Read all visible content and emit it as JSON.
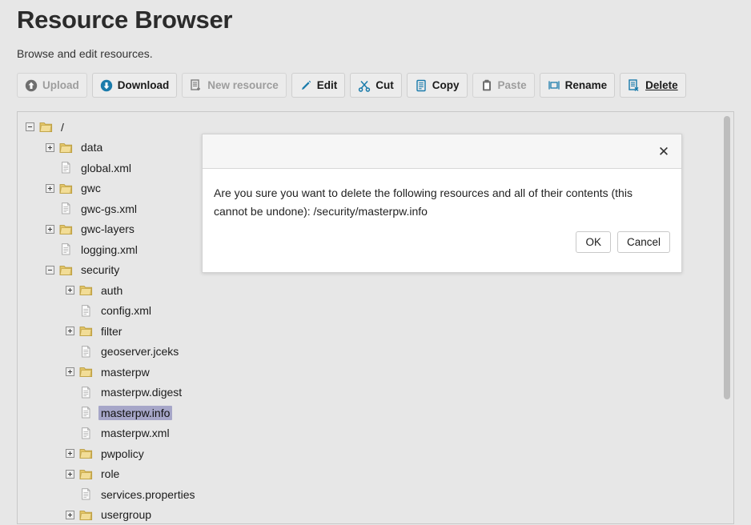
{
  "header": {
    "title": "Resource Browser",
    "subtitle": "Browse and edit resources."
  },
  "toolbar": {
    "buttons": [
      {
        "label": "Upload",
        "icon": "upload-circle-icon",
        "enabled": false,
        "focused": false
      },
      {
        "label": "Download",
        "icon": "download-circle-icon",
        "enabled": true,
        "focused": false
      },
      {
        "label": "New resource",
        "icon": "new-document-icon",
        "enabled": false,
        "focused": false
      },
      {
        "label": "Edit",
        "icon": "pencil-icon",
        "enabled": true,
        "focused": false
      },
      {
        "label": "Cut",
        "icon": "scissors-icon",
        "enabled": true,
        "focused": false
      },
      {
        "label": "Copy",
        "icon": "copy-document-icon",
        "enabled": true,
        "focused": false
      },
      {
        "label": "Paste",
        "icon": "clipboard-icon",
        "enabled": false,
        "focused": false
      },
      {
        "label": "Rename",
        "icon": "rename-icon",
        "enabled": true,
        "focused": false
      },
      {
        "label": "Delete",
        "icon": "delete-document-icon",
        "enabled": true,
        "focused": true
      }
    ]
  },
  "tree": {
    "nodes": [
      {
        "label": "/",
        "type": "folder",
        "state": "expanded",
        "depth": 0,
        "selected": false
      },
      {
        "label": "data",
        "type": "folder",
        "state": "collapsed",
        "depth": 1,
        "selected": false
      },
      {
        "label": "global.xml",
        "type": "file",
        "state": "leaf",
        "depth": 1,
        "selected": false
      },
      {
        "label": "gwc",
        "type": "folder",
        "state": "collapsed",
        "depth": 1,
        "selected": false
      },
      {
        "label": "gwc-gs.xml",
        "type": "file",
        "state": "leaf",
        "depth": 1,
        "selected": false
      },
      {
        "label": "gwc-layers",
        "type": "folder",
        "state": "collapsed",
        "depth": 1,
        "selected": false
      },
      {
        "label": "logging.xml",
        "type": "file",
        "state": "leaf",
        "depth": 1,
        "selected": false
      },
      {
        "label": "security",
        "type": "folder",
        "state": "expanded",
        "depth": 1,
        "selected": false
      },
      {
        "label": "auth",
        "type": "folder",
        "state": "collapsed",
        "depth": 2,
        "selected": false
      },
      {
        "label": "config.xml",
        "type": "file",
        "state": "leaf",
        "depth": 2,
        "selected": false
      },
      {
        "label": "filter",
        "type": "folder",
        "state": "collapsed",
        "depth": 2,
        "selected": false
      },
      {
        "label": "geoserver.jceks",
        "type": "file",
        "state": "leaf",
        "depth": 2,
        "selected": false
      },
      {
        "label": "masterpw",
        "type": "folder",
        "state": "collapsed",
        "depth": 2,
        "selected": false
      },
      {
        "label": "masterpw.digest",
        "type": "file",
        "state": "leaf",
        "depth": 2,
        "selected": false
      },
      {
        "label": "masterpw.info",
        "type": "file",
        "state": "leaf",
        "depth": 2,
        "selected": true
      },
      {
        "label": "masterpw.xml",
        "type": "file",
        "state": "leaf",
        "depth": 2,
        "selected": false
      },
      {
        "label": "pwpolicy",
        "type": "folder",
        "state": "collapsed",
        "depth": 2,
        "selected": false
      },
      {
        "label": "role",
        "type": "folder",
        "state": "collapsed",
        "depth": 2,
        "selected": false
      },
      {
        "label": "services.properties",
        "type": "file",
        "state": "leaf",
        "depth": 2,
        "selected": false
      },
      {
        "label": "usergroup",
        "type": "folder",
        "state": "collapsed",
        "depth": 2,
        "selected": false
      }
    ]
  },
  "dialog": {
    "close_icon": "✕",
    "message": "Are you sure you want to delete the following resources and all of their contents (this cannot be undone): /security/masterpw.info",
    "ok_label": "OK",
    "cancel_label": "Cancel"
  },
  "colors": {
    "page_background": "#e7e7e7",
    "accent_blue": "#1a7bab",
    "selection_purple": "#a6a6c8",
    "folder_yellow": "#e8c96a",
    "disabled_gray": "#9d9d9d"
  }
}
